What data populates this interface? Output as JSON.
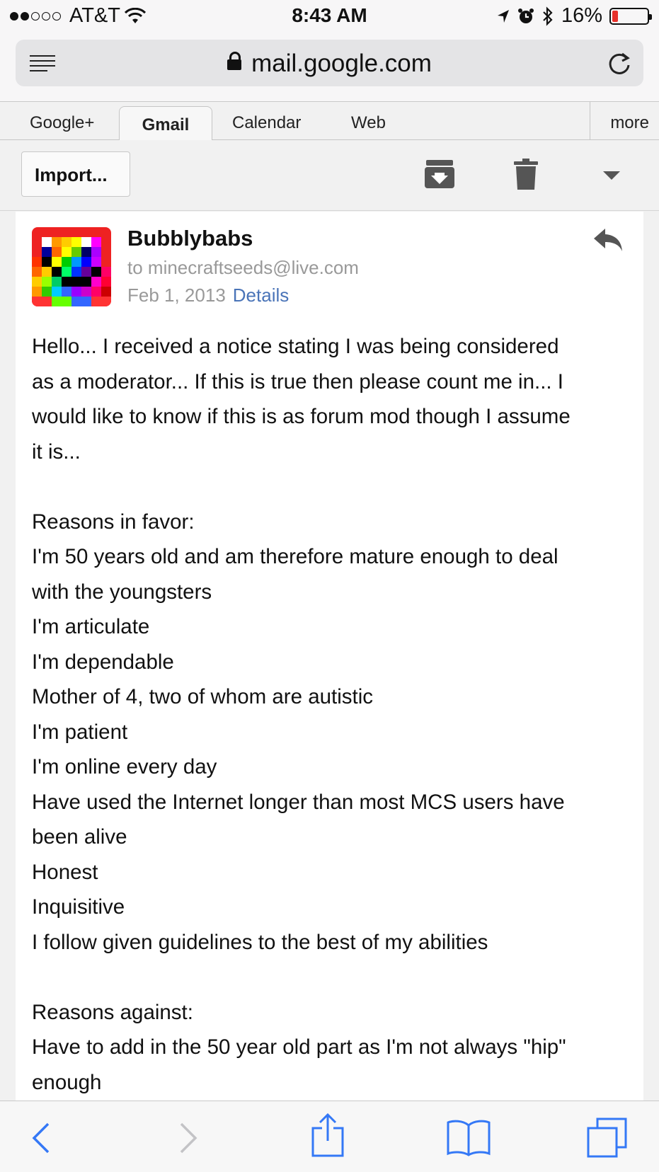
{
  "status_bar": {
    "carrier": "AT&T",
    "time": "8:43 AM",
    "battery": "16%",
    "battery_level": 0.16,
    "signal_bars_filled": 2,
    "signal_bars_total": 5,
    "icons": [
      "wifi-icon",
      "location-arrow-icon",
      "alarm-icon",
      "bluetooth-icon",
      "battery-icon"
    ]
  },
  "browser": {
    "url": "mail.google.com",
    "icons": [
      "reader-icon",
      "lock-icon",
      "reload-icon"
    ]
  },
  "google_nav": {
    "tabs": [
      "Google+",
      "Gmail",
      "Calendar",
      "Web"
    ],
    "active_tab": "Gmail",
    "more": "more"
  },
  "toolbar": {
    "back_label": "Import...",
    "icons": [
      "archive-icon",
      "trash-icon",
      "dropdown-arrow-icon"
    ]
  },
  "email": {
    "sender": "Bubblybabs",
    "to": "to minecraftseeds@live.com",
    "date": "Feb 1, 2013",
    "details_link": "Details",
    "body_lines": [
      "Hello...  I received a notice stating I was being considered",
      "as a moderator...  If this is true then please count me in...  I",
      "would like to know if this is as forum mod though I assume",
      "it is...",
      "",
      "Reasons in favor:",
      "I'm 50 years old and am therefore mature enough to deal",
      "with the youngsters",
      "I'm articulate",
      "I'm dependable",
      "Mother of 4, two of whom are autistic",
      "I'm patient",
      "I'm online every day",
      "Have used the Internet longer than most MCS users have",
      "been alive",
      "Honest",
      "Inquisitive",
      "I follow given guidelines to the best of my abilities",
      "",
      "Reasons against:",
      "Have to add in the 50 year old part as I'm not always \"hip\"",
      "enough"
    ]
  },
  "bottom_bar": {
    "icons": [
      "back-icon",
      "forward-icon",
      "share-icon",
      "bookmarks-icon",
      "tabs-icon"
    ]
  },
  "colors": {
    "link": "#4a74b8",
    "meta_text": "#999999",
    "battery_low": "#e8302a",
    "ios_blue": "#3478f6"
  }
}
